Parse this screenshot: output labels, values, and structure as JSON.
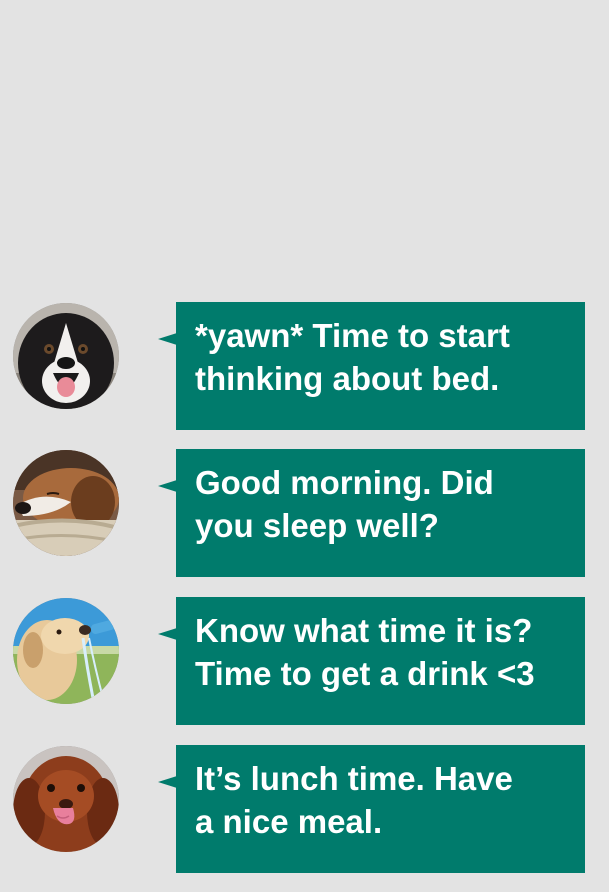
{
  "colors": {
    "background": "#e3e3e3",
    "bubble": "#007b6c",
    "bubble_text": "#ffffff"
  },
  "messages": [
    {
      "avatar_icon": "border-collie-dog-avatar",
      "text": "*yawn* Time to start\nthinking about bed."
    },
    {
      "avatar_icon": "sleeping-beagle-dog-avatar",
      "text": "Good morning. Did\nyou sleep well?"
    },
    {
      "avatar_icon": "labrador-drinking-dog-avatar",
      "text": "Know what time it is?\nTime to get a drink <3"
    },
    {
      "avatar_icon": "spaniel-licking-dog-avatar",
      "text": "It’s lunch time. Have\na nice meal."
    }
  ]
}
